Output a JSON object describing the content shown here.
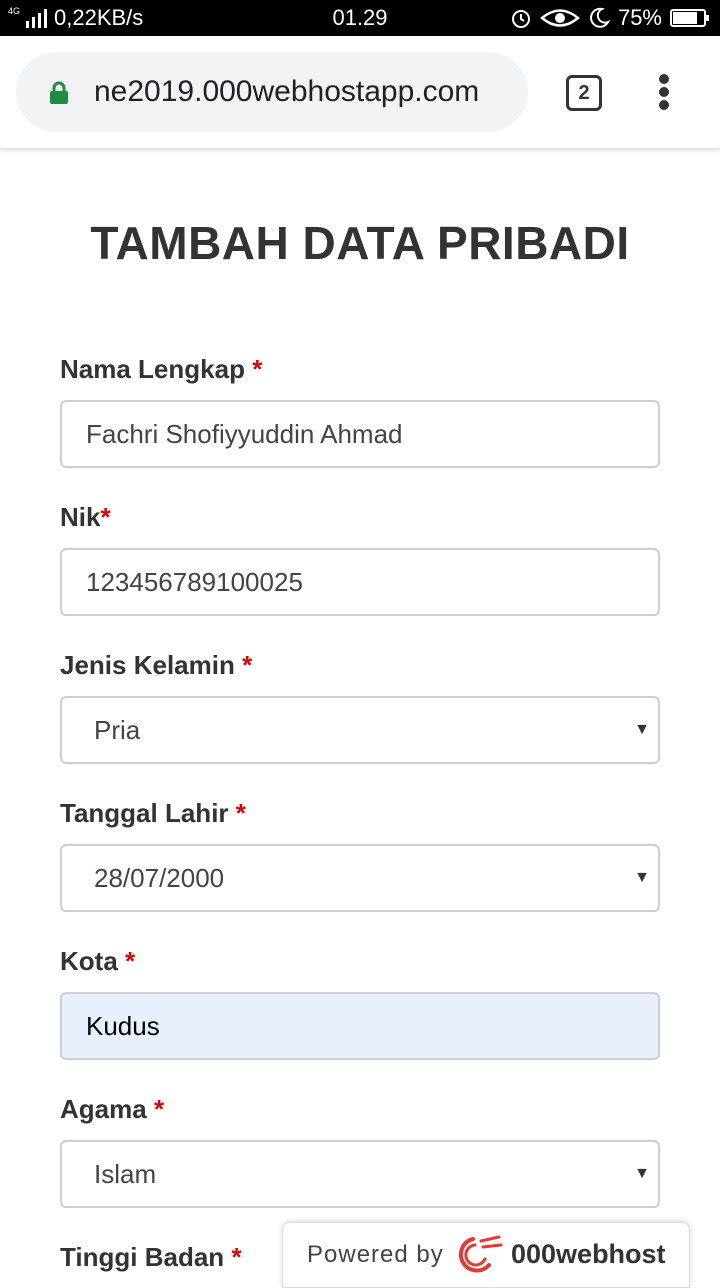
{
  "status_bar": {
    "network_type": "4G",
    "speed": "0,22KB/s",
    "time": "01.29",
    "battery": "75%"
  },
  "browser": {
    "url": "ne2019.000webhostapp.com",
    "tab_count": "2"
  },
  "form": {
    "title": "TAMBAH DATA PRIBADI",
    "required_mark": "*",
    "fields": [
      {
        "label": "Nama Lengkap",
        "value": "Fachri Shofiyyuddin Ahmad"
      },
      {
        "label": "Nik",
        "value": "123456789100025"
      },
      {
        "label": "Jenis Kelamin",
        "value": "Pria"
      },
      {
        "label": "Tanggal Lahir",
        "value": "28/07/2000"
      },
      {
        "label": "Kota",
        "value": "Kudus"
      },
      {
        "label": "Agama",
        "value": "Islam"
      },
      {
        "label": "Tinggi Badan"
      }
    ]
  },
  "badge": {
    "prefix": "Powered by",
    "brand": "000webhost"
  },
  "icons": {
    "lock": "lock-icon",
    "menu": "more-vert-icon",
    "signal": "signal-icon",
    "alarm": "alarm-icon",
    "eye": "eye-icon",
    "moon": "moon-icon",
    "battery": "battery-icon"
  },
  "colors": {
    "required": "#e00000",
    "lock": "#1e8e3e",
    "autofill_bg": "#e8f0fe",
    "badge_logo": "#e53935"
  }
}
